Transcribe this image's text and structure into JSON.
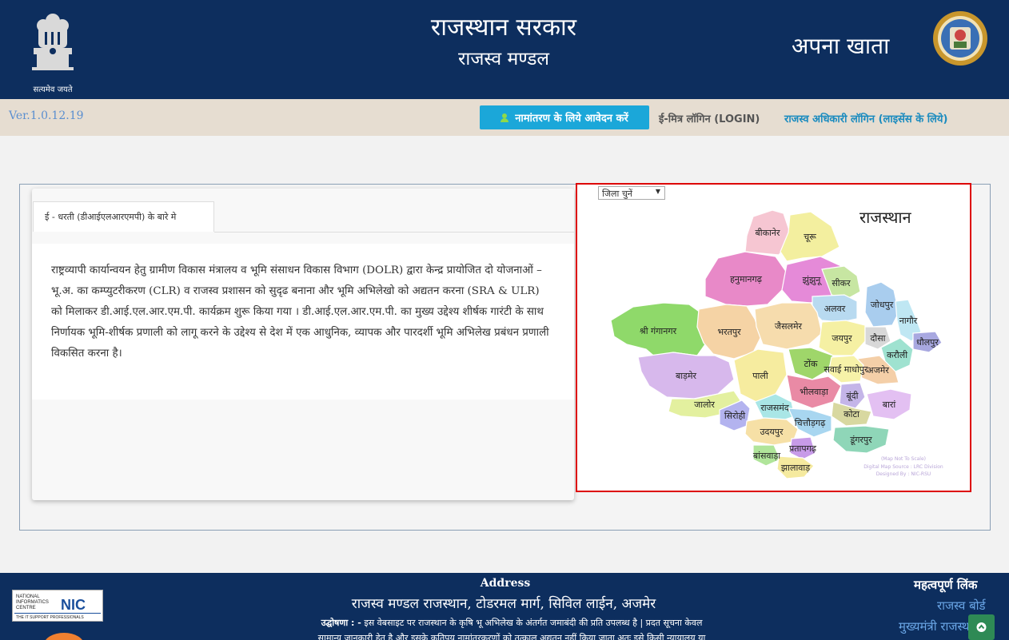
{
  "header": {
    "emblem_caption": "सत्यमेव जयते",
    "gov_title": "राजस्थान सरकार",
    "dept_name": "राजस्व मण्डल",
    "portal_name": "अपना खाता"
  },
  "navbar": {
    "version": "Ver.1.0.12.19",
    "apply_button": "नामांतरण के लिये आवेदन करें",
    "emitra_login": "ई-मित्र लॉगिन (LOGIN)",
    "officer_login": "राजस्व अधिकारी लॉगिन (लाइसेंस के लिये)"
  },
  "info": {
    "tab_label": "ई - धरती (डीआईएलआरएमपी) के बारे मे",
    "body": "राष्ट्रव्यापी कार्यान्वयन हेतु ग्रामीण विकास मंत्रालय व भूमि संसाधन विकास विभाग (DOLR) द्वारा केन्द्र प्रायोजित दो योजनाओं – भू.अ. का कम्प्युटरीकरण (CLR) व राजस्व प्रशासन को सुदृढ बनाना और भूमि अभिलेखो को अद्यतन करना (SRA & ULR) को मिलाकर डी.आई.एल.आर.एम.पी. कार्यक्रम शुरू किया गया । डी.आई.एल.आर.एम.पी. का मुख्य उद्देश्य शीर्षक गारंटी के साथ निर्णायक भूमि-शीर्षक प्रणाली को लागू करने के उद्देश्य से देश में एक आधुनिक, व्यापक और पारदर्शी भूमि अभिलेख प्रबंधन प्रणाली विकसित करना है।"
  },
  "map": {
    "select_label": "जिला चुनें",
    "title": "राजस्थान",
    "note_1": "(Map Not To Scale)",
    "note_2": "Digital Map Source : LRC Division",
    "note_3": "Designed By : NIC-RSU",
    "districts": [
      {
        "name": "श्री गंगानगर",
        "color": "#8fd96a"
      },
      {
        "name": "हनुमानगढ़",
        "color": "#e889c8"
      },
      {
        "name": "बीकानेर",
        "color": "#f6c6d2"
      },
      {
        "name": "चूरू",
        "color": "#f3ef9f"
      },
      {
        "name": "झुंझुनू",
        "color": "#e58ad8"
      },
      {
        "name": "सीकर",
        "color": "#c7e6a2"
      },
      {
        "name": "अलवर",
        "color": "#b8daf0"
      },
      {
        "name": "भरतपुर",
        "color": "#f5d3a5"
      },
      {
        "name": "जैसलमेर",
        "color": "#f6dcad"
      },
      {
        "name": "जोधपुर",
        "color": "#a9cdee"
      },
      {
        "name": "नागौर",
        "color": "#bfe7f3"
      },
      {
        "name": "जयपुर",
        "color": "#f5f0a3"
      },
      {
        "name": "दौसा",
        "color": "#d8d8d8"
      },
      {
        "name": "धौलपुर",
        "color": "#a8a8e0"
      },
      {
        "name": "करौली",
        "color": "#9fe2d0"
      },
      {
        "name": "अजमेर",
        "color": "#f4cfa8"
      },
      {
        "name": "टोंक",
        "color": "#9fd66a"
      },
      {
        "name": "सवाई माधोपुर",
        "color": "#f6f2a8"
      },
      {
        "name": "बाड़मेर",
        "color": "#d7b8ec"
      },
      {
        "name": "पाली",
        "color": "#f6ec9f"
      },
      {
        "name": "भीलवाड़ा",
        "color": "#e98aa5"
      },
      {
        "name": "बूंदी",
        "color": "#c4b5e8"
      },
      {
        "name": "जालोर",
        "color": "#e3f09f"
      },
      {
        "name": "सिरोही",
        "color": "#b3b3ef"
      },
      {
        "name": "राजसमंद",
        "color": "#a9e6e6"
      },
      {
        "name": "चित्तौड़गढ़",
        "color": "#a8d6f0"
      },
      {
        "name": "कोटा",
        "color": "#d8d8a0"
      },
      {
        "name": "बारां",
        "color": "#e3c0f2"
      },
      {
        "name": "उदयपुर",
        "color": "#f6e0a6"
      },
      {
        "name": "प्रतापगढ़",
        "color": "#c79be8"
      },
      {
        "name": "डूंगरपुर",
        "color": "#8fd6b8"
      },
      {
        "name": "बांसवाड़ा",
        "color": "#b0e59a"
      },
      {
        "name": "झालावाड़",
        "color": "#f5ea9f"
      }
    ]
  },
  "footer": {
    "address_head": "Address",
    "address": "राजस्व मण्डल राजस्थान, टोडरमल मार्ग, सिविल लाईन, अजमेर",
    "disclaimer_label": "उद्घोषणा : -",
    "disclaimer_1": "इस वेबसाइट पर राजस्थान के कृषि भू अभिलेख के अंतर्गत जमाबंदी की प्रति उपलब्ध है | प्रदत सूचना केवल",
    "disclaimer_2": "सामान्य जानकारी हेतु है और इसके कतिपय नामांतरकरणों को तत्काल अद्यतन नहीं किया जाता अतः इसे किसी न्यायालय या",
    "links_head": "महत्वपूर्ण लिंक",
    "link_1": "राजस्व बोर्ड",
    "link_2": "मुख्यमंत्री राजस्थान"
  },
  "nic": {
    "line1": "NATIONAL",
    "line2": "INFORMATICS",
    "line3": "CENTRE",
    "acronym": "NIC",
    "tagline": "THE IT SUPPORT PROFESSIONALS"
  }
}
